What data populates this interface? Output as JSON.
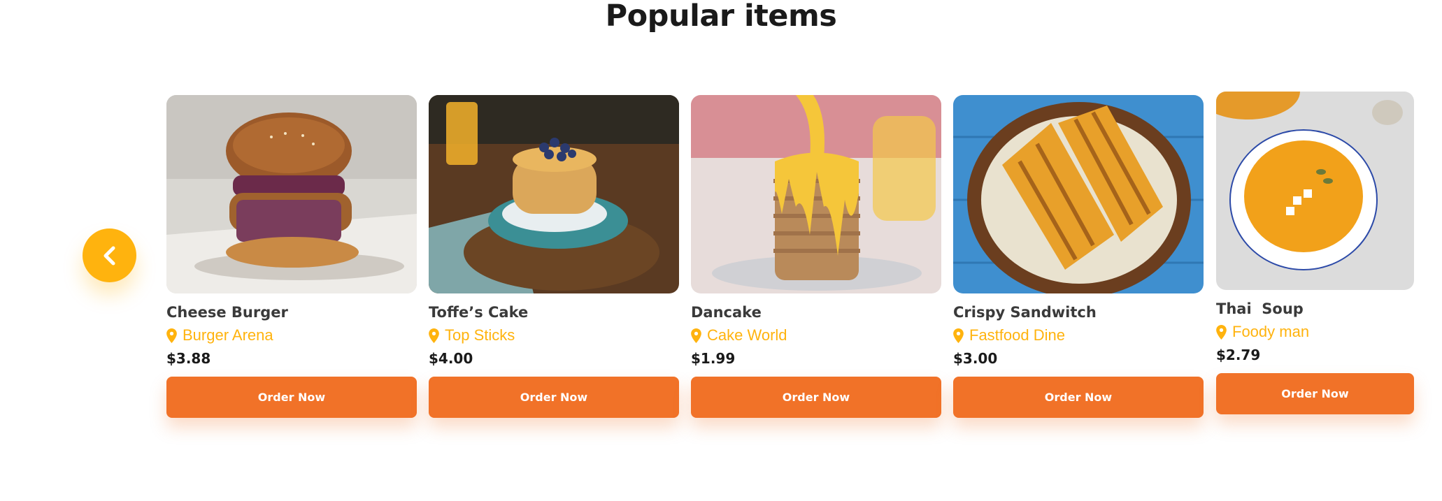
{
  "section": {
    "title": "Popular items"
  },
  "carousel": {
    "prev_icon": "chevron-left-icon"
  },
  "colors": {
    "accent_yellow": "#ffb30e",
    "order_orange": "#f17228"
  },
  "items": [
    {
      "name": "Cheese Burger",
      "location": "Burger Arena",
      "price": "$3.88",
      "button": "Order Now"
    },
    {
      "name": "Toffe’s Cake",
      "location": "Top Sticks",
      "price": "$4.00",
      "button": "Order Now"
    },
    {
      "name": "Dancake",
      "location": "Cake World",
      "price": "$1.99",
      "button": "Order Now"
    },
    {
      "name": "Crispy Sandwitch",
      "location": "Fastfood Dine",
      "price": "$3.00",
      "button": "Order Now"
    },
    {
      "name": "Thai  Soup",
      "location": "Foody man",
      "price": "$2.79",
      "button": "Order Now"
    }
  ]
}
